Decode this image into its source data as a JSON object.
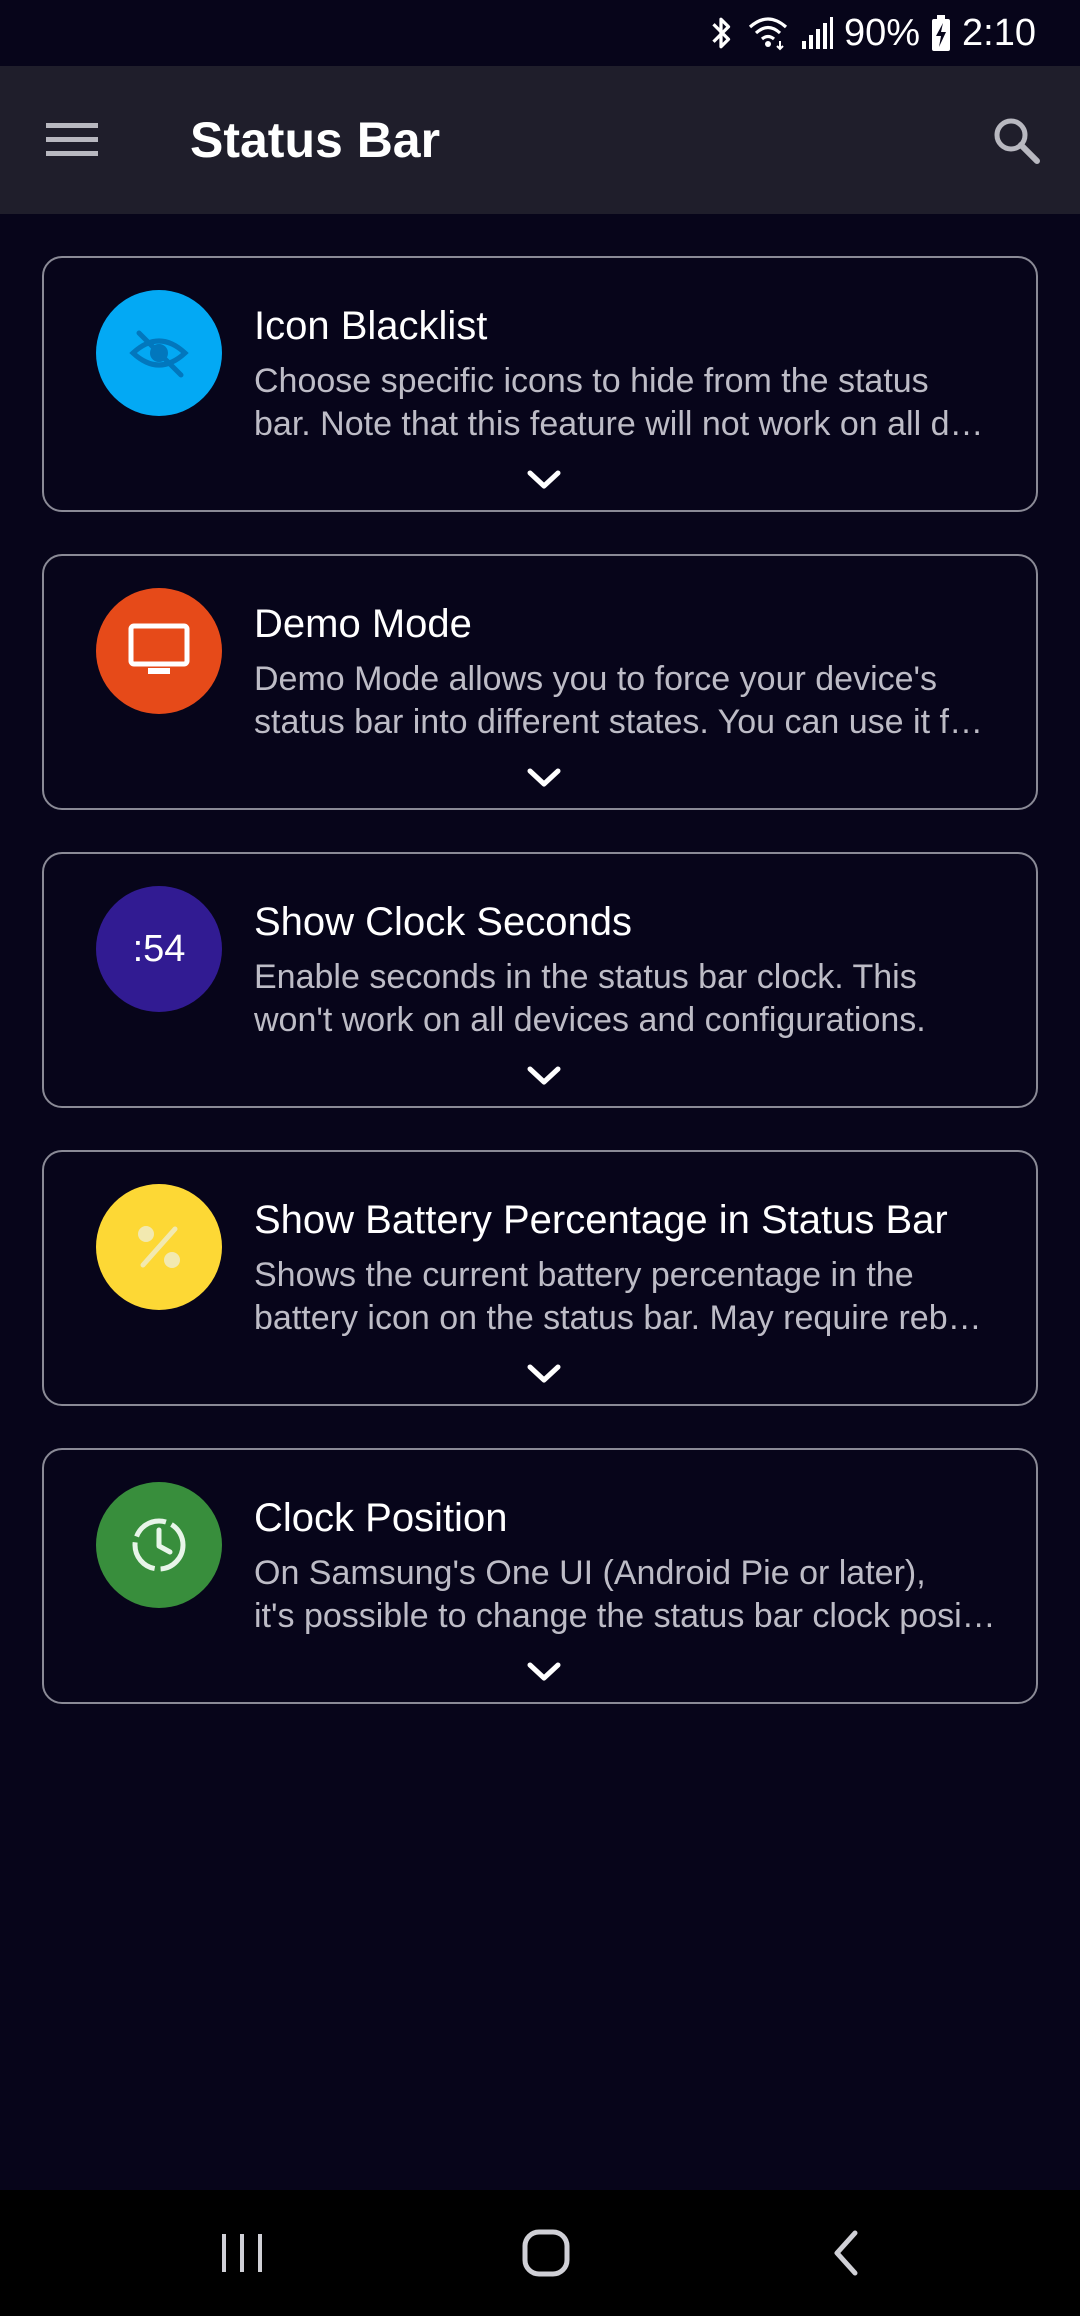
{
  "status_bar": {
    "battery": "90%",
    "time": "2:10",
    "icons": [
      "bluetooth-icon",
      "wifi-icon",
      "signal-icon",
      "battery-charging-icon"
    ]
  },
  "app_bar": {
    "title": "Status Bar",
    "menu_icon": "hamburger-menu-icon",
    "search_icon": "search-icon"
  },
  "cards": [
    {
      "title": "Icon Blacklist",
      "desc_line1": "Choose specific icons to hide from the status",
      "desc_line2": "bar. Note that this feature will not work on all devices.",
      "icon": "eye-off-icon",
      "icon_color": "#03a9f4"
    },
    {
      "title": "Demo Mode",
      "desc_line1": "Demo Mode allows you to force your device's",
      "desc_line2": "status bar into different states. You can use it for screenshots.",
      "icon": "monitor-icon",
      "icon_color": "#e64a19"
    },
    {
      "title": "Show Clock Seconds",
      "desc_line1": "Enable seconds in the status bar clock. This",
      "desc_line2": "won't work on all devices and configurations.",
      "icon_text": ":54",
      "icon_color": "#311b92"
    },
    {
      "title": "Show Battery Percentage in Status Bar",
      "desc_line1": "Shows the current battery percentage in the",
      "desc_line2": "battery icon on the status bar. May require reboot.",
      "icon": "percent-icon",
      "icon_color": "#fdd835"
    },
    {
      "title": "Clock Position",
      "desc_line1": "On Samsung's One UI (Android Pie or later),",
      "desc_line2": "it's possible to change the status bar clock position.",
      "icon": "clock-icon",
      "icon_color": "#388e3c"
    }
  ],
  "nav_bar": {
    "recents_icon": "recents-icon",
    "home_icon": "home-icon",
    "back_icon": "back-icon"
  }
}
